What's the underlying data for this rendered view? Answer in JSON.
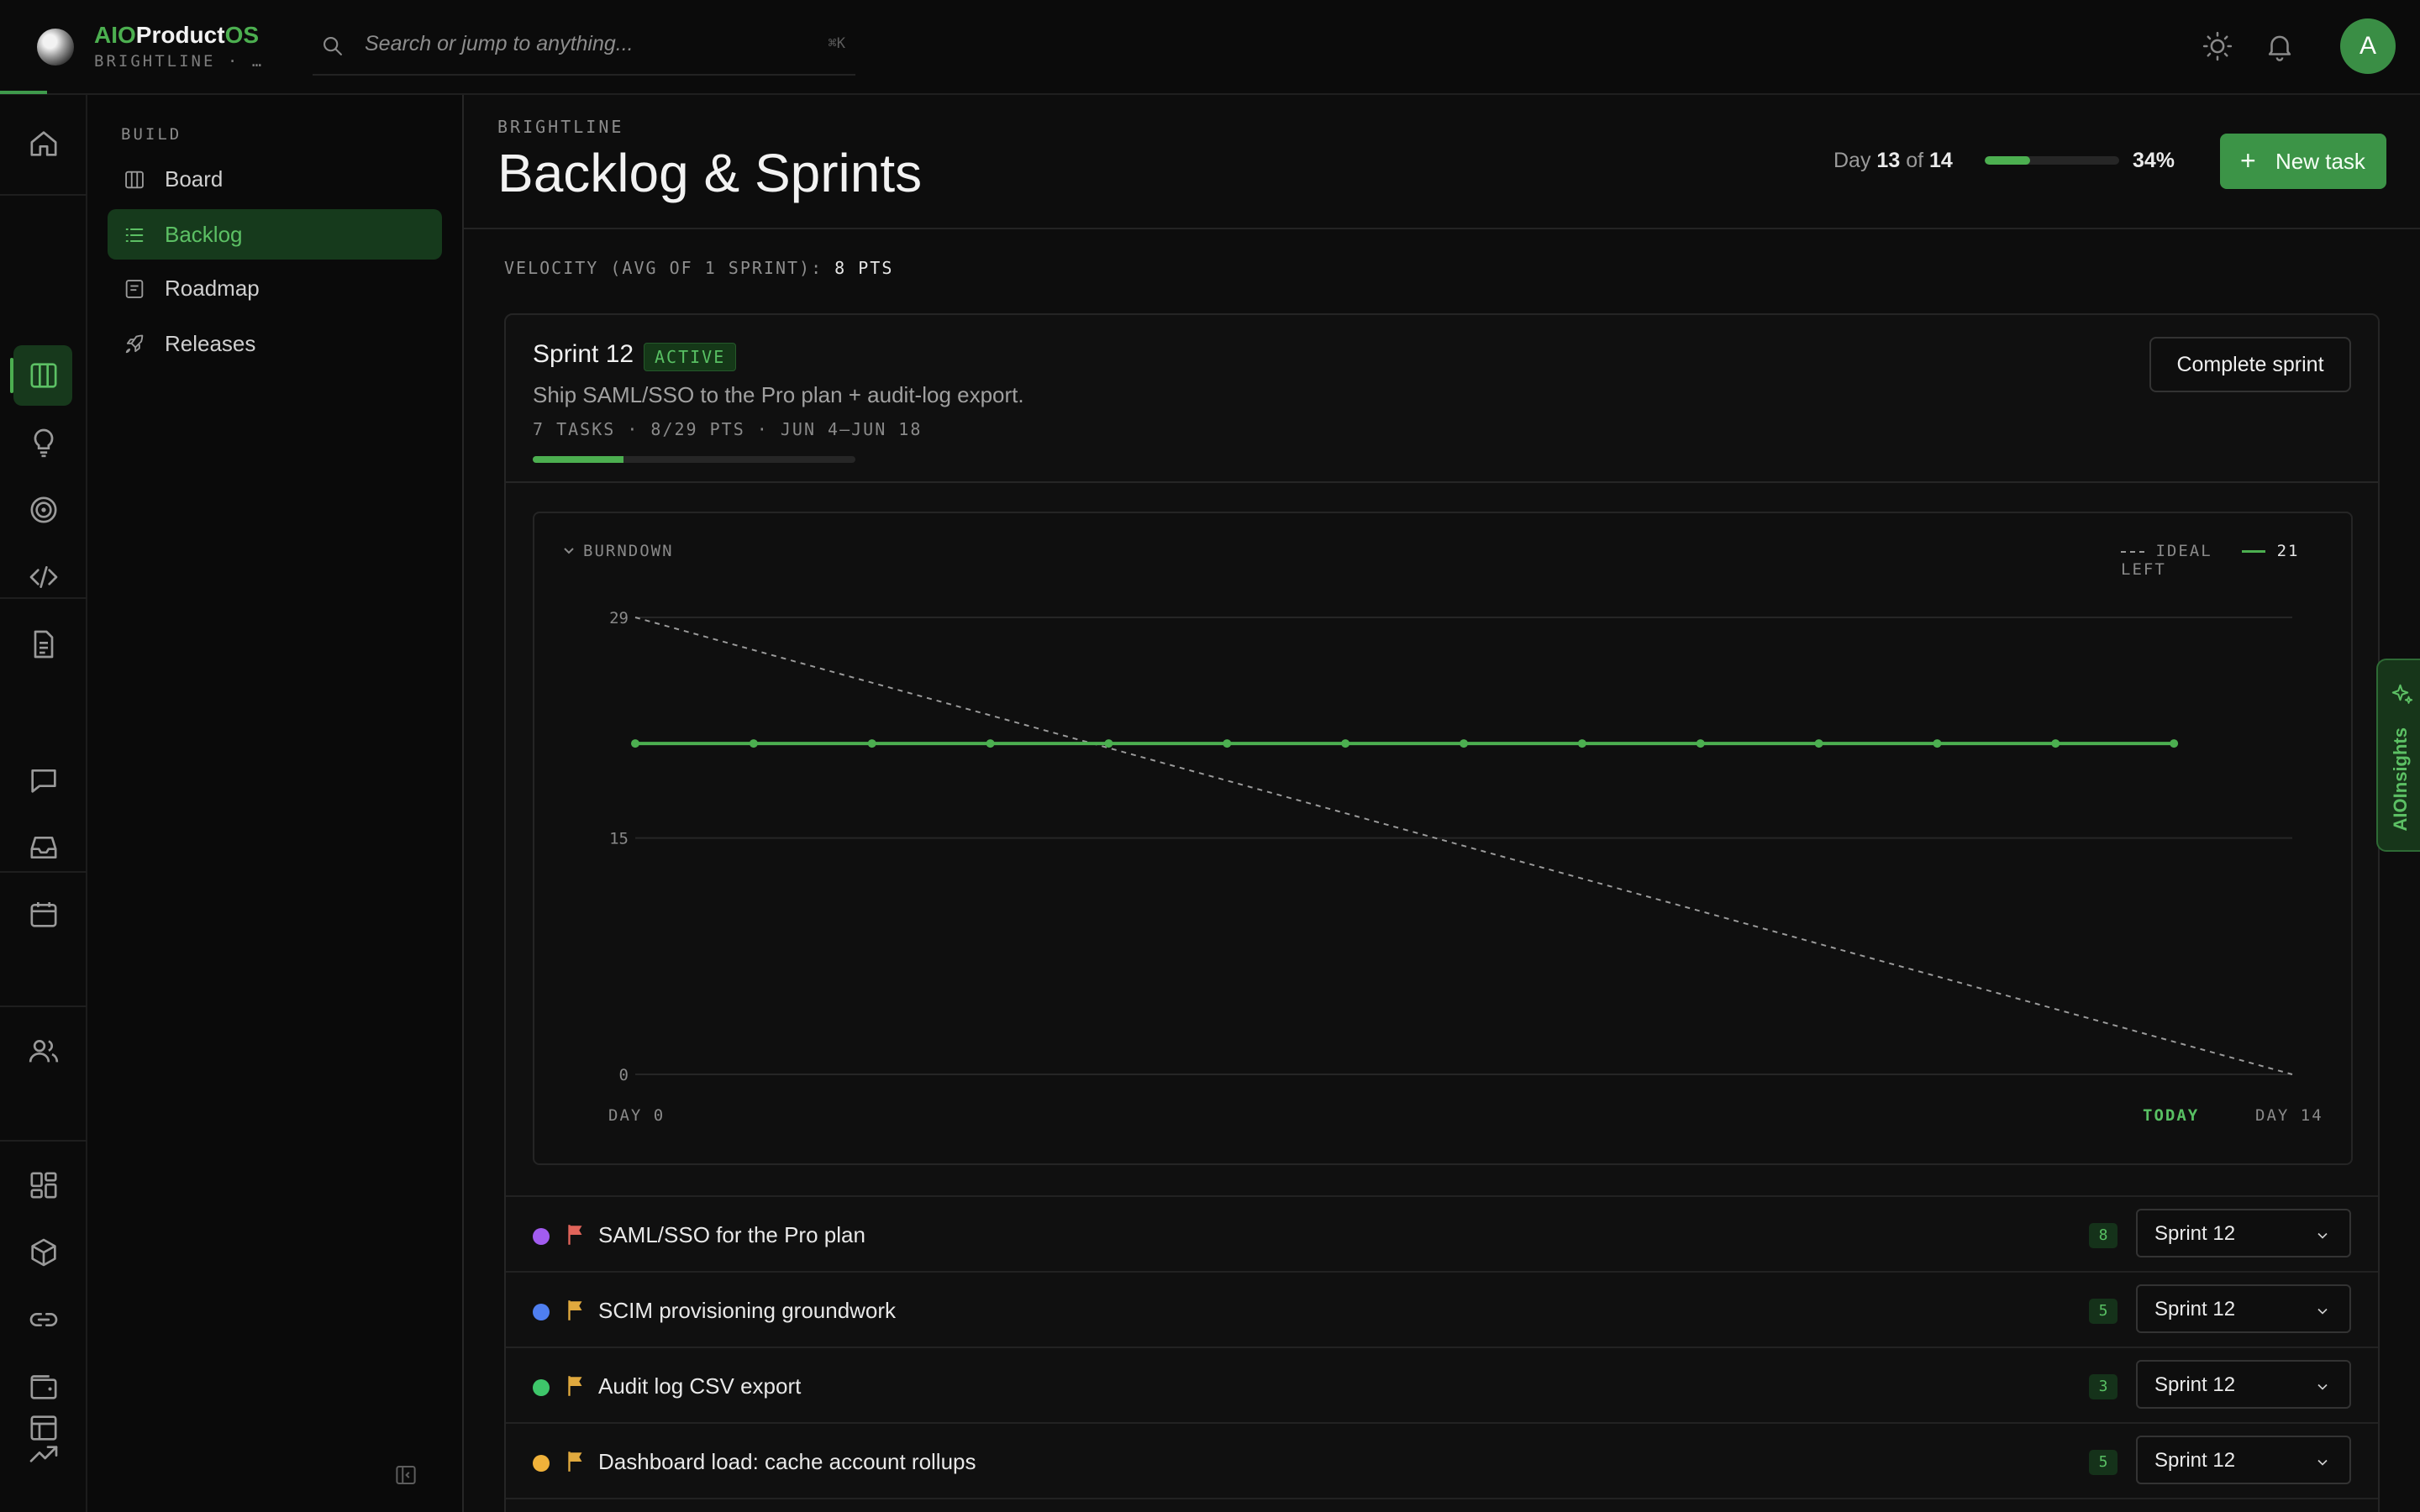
{
  "app": {
    "name_part1": "AIO",
    "name_part2": "Product",
    "name_part3": "OS",
    "org": "BRIGHTLINE · BRIGHTLINE"
  },
  "search": {
    "placeholder": "Search or jump to anything...",
    "shortcut": "⌘K"
  },
  "user": {
    "initial": "A"
  },
  "sidebar": {
    "section_title": "BUILD",
    "items": [
      {
        "label": "Board",
        "icon": "board-icon"
      },
      {
        "label": "Backlog",
        "icon": "list-icon",
        "active": true
      },
      {
        "label": "Roadmap",
        "icon": "roadmap-icon"
      },
      {
        "label": "Releases",
        "icon": "rocket-icon"
      }
    ]
  },
  "header": {
    "breadcrumb": "BRIGHTLINE",
    "title": "Backlog & Sprints",
    "day_label": "Day",
    "day_current": "13",
    "day_of": "of",
    "day_total": "14",
    "progress_percent": "34%",
    "progress_fraction": 0.34,
    "new_task_label": "New task"
  },
  "velocity": {
    "label": "VELOCITY (AVG OF 1 SPRINT):",
    "value": "8 PTS"
  },
  "sprint": {
    "name": "Sprint 12",
    "status": "ACTIVE",
    "goal": "Ship SAML/SSO to the Pro plan + audit-log export.",
    "meta": "7 TASKS · 8/29 PTS · JUN 4–JUN 18",
    "progress_fraction": 0.28,
    "complete_label": "Complete sprint"
  },
  "burndown": {
    "title": "BURNDOWN",
    "legend_ideal": "IDEAL",
    "legend_actual_value": "21",
    "legend_actual_suffix": "LEFT",
    "x_start_label": "DAY 0",
    "x_today_label": "TODAY",
    "x_end_label": "DAY 14"
  },
  "chart_data": {
    "type": "line",
    "title": "BURNDOWN",
    "x": [
      0,
      1,
      2,
      3,
      4,
      5,
      6,
      7,
      8,
      9,
      10,
      11,
      12,
      13,
      14
    ],
    "ylim": [
      0,
      29
    ],
    "yticks": [
      0,
      15,
      29
    ],
    "series": [
      {
        "name": "IDEAL",
        "style": "dashed",
        "color": "#9a9a9a",
        "x": [
          0,
          14
        ],
        "values": [
          29,
          0
        ]
      },
      {
        "name": "LEFT",
        "style": "solid",
        "color": "#4caf50",
        "x": [
          0,
          1,
          2,
          3,
          4,
          5,
          6,
          7,
          8,
          9,
          10,
          11,
          12,
          13
        ],
        "values": [
          21,
          21,
          21,
          21,
          21,
          21,
          21,
          21,
          21,
          21,
          21,
          21,
          21,
          21
        ]
      }
    ],
    "grid": true,
    "legend": "top-right"
  },
  "tasks": [
    {
      "title": "SAML/SSO for the Pro plan",
      "points": "8",
      "sprint": "Sprint 12",
      "dot_color": "#a25cf0",
      "flag_color": "#e0645a"
    },
    {
      "title": "SCIM provisioning groundwork",
      "points": "5",
      "sprint": "Sprint 12",
      "dot_color": "#4f7ff0",
      "flag_color": "#e0a93e"
    },
    {
      "title": "Audit log CSV export",
      "points": "3",
      "sprint": "Sprint 12",
      "dot_color": "#3ec66a",
      "flag_color": "#e0a93e"
    },
    {
      "title": "Dashboard load: cache account rollups",
      "points": "5",
      "sprint": "Sprint 12",
      "dot_color": "#f0b23a",
      "flag_color": "#e0a93e"
    }
  ],
  "ai_panel": {
    "label": "AIOInsights"
  },
  "colors": {
    "accent": "#4caf50",
    "background": "#0b0b0b"
  }
}
